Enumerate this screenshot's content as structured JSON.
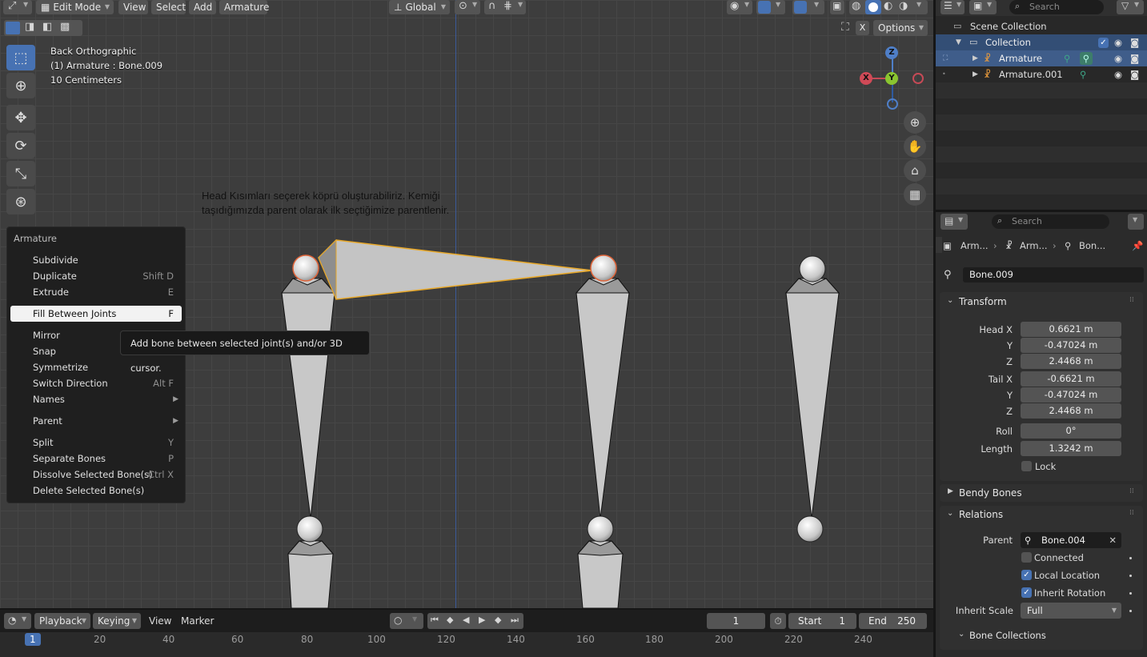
{
  "header": {
    "mode": "Edit Mode",
    "menus": [
      "View",
      "Select",
      "Add",
      "Armature"
    ],
    "orientation": "Global",
    "options": "Options",
    "x_label": "X"
  },
  "overlay": {
    "view_name": "Back Orthographic",
    "object_line": "(1) Armature : Bone.009",
    "scale": "10 Centimeters"
  },
  "gizmo": {
    "z": "Z",
    "y": "Y",
    "x": "X"
  },
  "annotation": {
    "line1": "Head Kısımları seçerek köprü oluşturabiliriz. Kemiği",
    "line2": "taşıdığımızda parent olarak ilk seçtiğimize parentlenir."
  },
  "menu": {
    "title": "Armature",
    "items": [
      {
        "label": "Subdivide",
        "shortcut": ""
      },
      {
        "label": "Duplicate",
        "shortcut": "Shift D"
      },
      {
        "label": "Extrude",
        "shortcut": "E"
      },
      {
        "label": "Fill Between Joints",
        "shortcut": "F"
      },
      {
        "label": "Mirror",
        "shortcut": ""
      },
      {
        "label": "Snap",
        "shortcut": ""
      },
      {
        "label": "Symmetrize",
        "shortcut": ""
      },
      {
        "label": "Switch Direction",
        "shortcut": "Alt F"
      },
      {
        "label": "Names",
        "shortcut": ""
      },
      {
        "label": "Parent",
        "shortcut": ""
      },
      {
        "label": "Split",
        "shortcut": "Y"
      },
      {
        "label": "Separate Bones",
        "shortcut": "P"
      },
      {
        "label": "Dissolve Selected Bone(s)",
        "shortcut": "Ctrl X"
      },
      {
        "label": "Delete Selected Bone(s)",
        "shortcut": ""
      }
    ],
    "tooltip": "Add bone between selected joint(s) and/or 3D cursor."
  },
  "timeline": {
    "playback": "Playback",
    "keying": "Keying",
    "view": "View",
    "marker": "Marker",
    "current_frame": "1",
    "start_label": "Start",
    "start": "1",
    "end_label": "End",
    "end": "250",
    "ruler": [
      "1",
      "20",
      "40",
      "60",
      "80",
      "100",
      "120",
      "140",
      "160",
      "180",
      "200",
      "220",
      "240"
    ]
  },
  "outliner": {
    "search_placeholder": "Search",
    "scene_collection": "Scene Collection",
    "collection": "Collection",
    "items": [
      "Armature",
      "Armature.001"
    ]
  },
  "properties": {
    "search_placeholder": "Search",
    "breadcrumb": [
      "Arm...",
      "Arm...",
      "Bon..."
    ],
    "bone_name": "Bone.009",
    "transform": {
      "title": "Transform",
      "head_x_label": "Head X",
      "head_x": "0.6621 m",
      "head_y_label": "Y",
      "head_y": "-0.47024 m",
      "head_z_label": "Z",
      "head_z": "2.4468 m",
      "tail_x_label": "Tail X",
      "tail_x": "-0.6621 m",
      "tail_y_label": "Y",
      "tail_y": "-0.47024 m",
      "tail_z_label": "Z",
      "tail_z": "2.4468 m",
      "roll_label": "Roll",
      "roll": "0°",
      "length_label": "Length",
      "length": "1.3242 m",
      "lock_label": "Lock"
    },
    "bendy_bones": "Bendy Bones",
    "relations": {
      "title": "Relations",
      "parent_label": "Parent",
      "parent": "Bone.004",
      "connected": "Connected",
      "local_location": "Local Location",
      "inherit_rotation": "Inherit Rotation",
      "inherit_scale_label": "Inherit Scale",
      "inherit_scale": "Full"
    },
    "bone_collections": "Bone Collections"
  }
}
